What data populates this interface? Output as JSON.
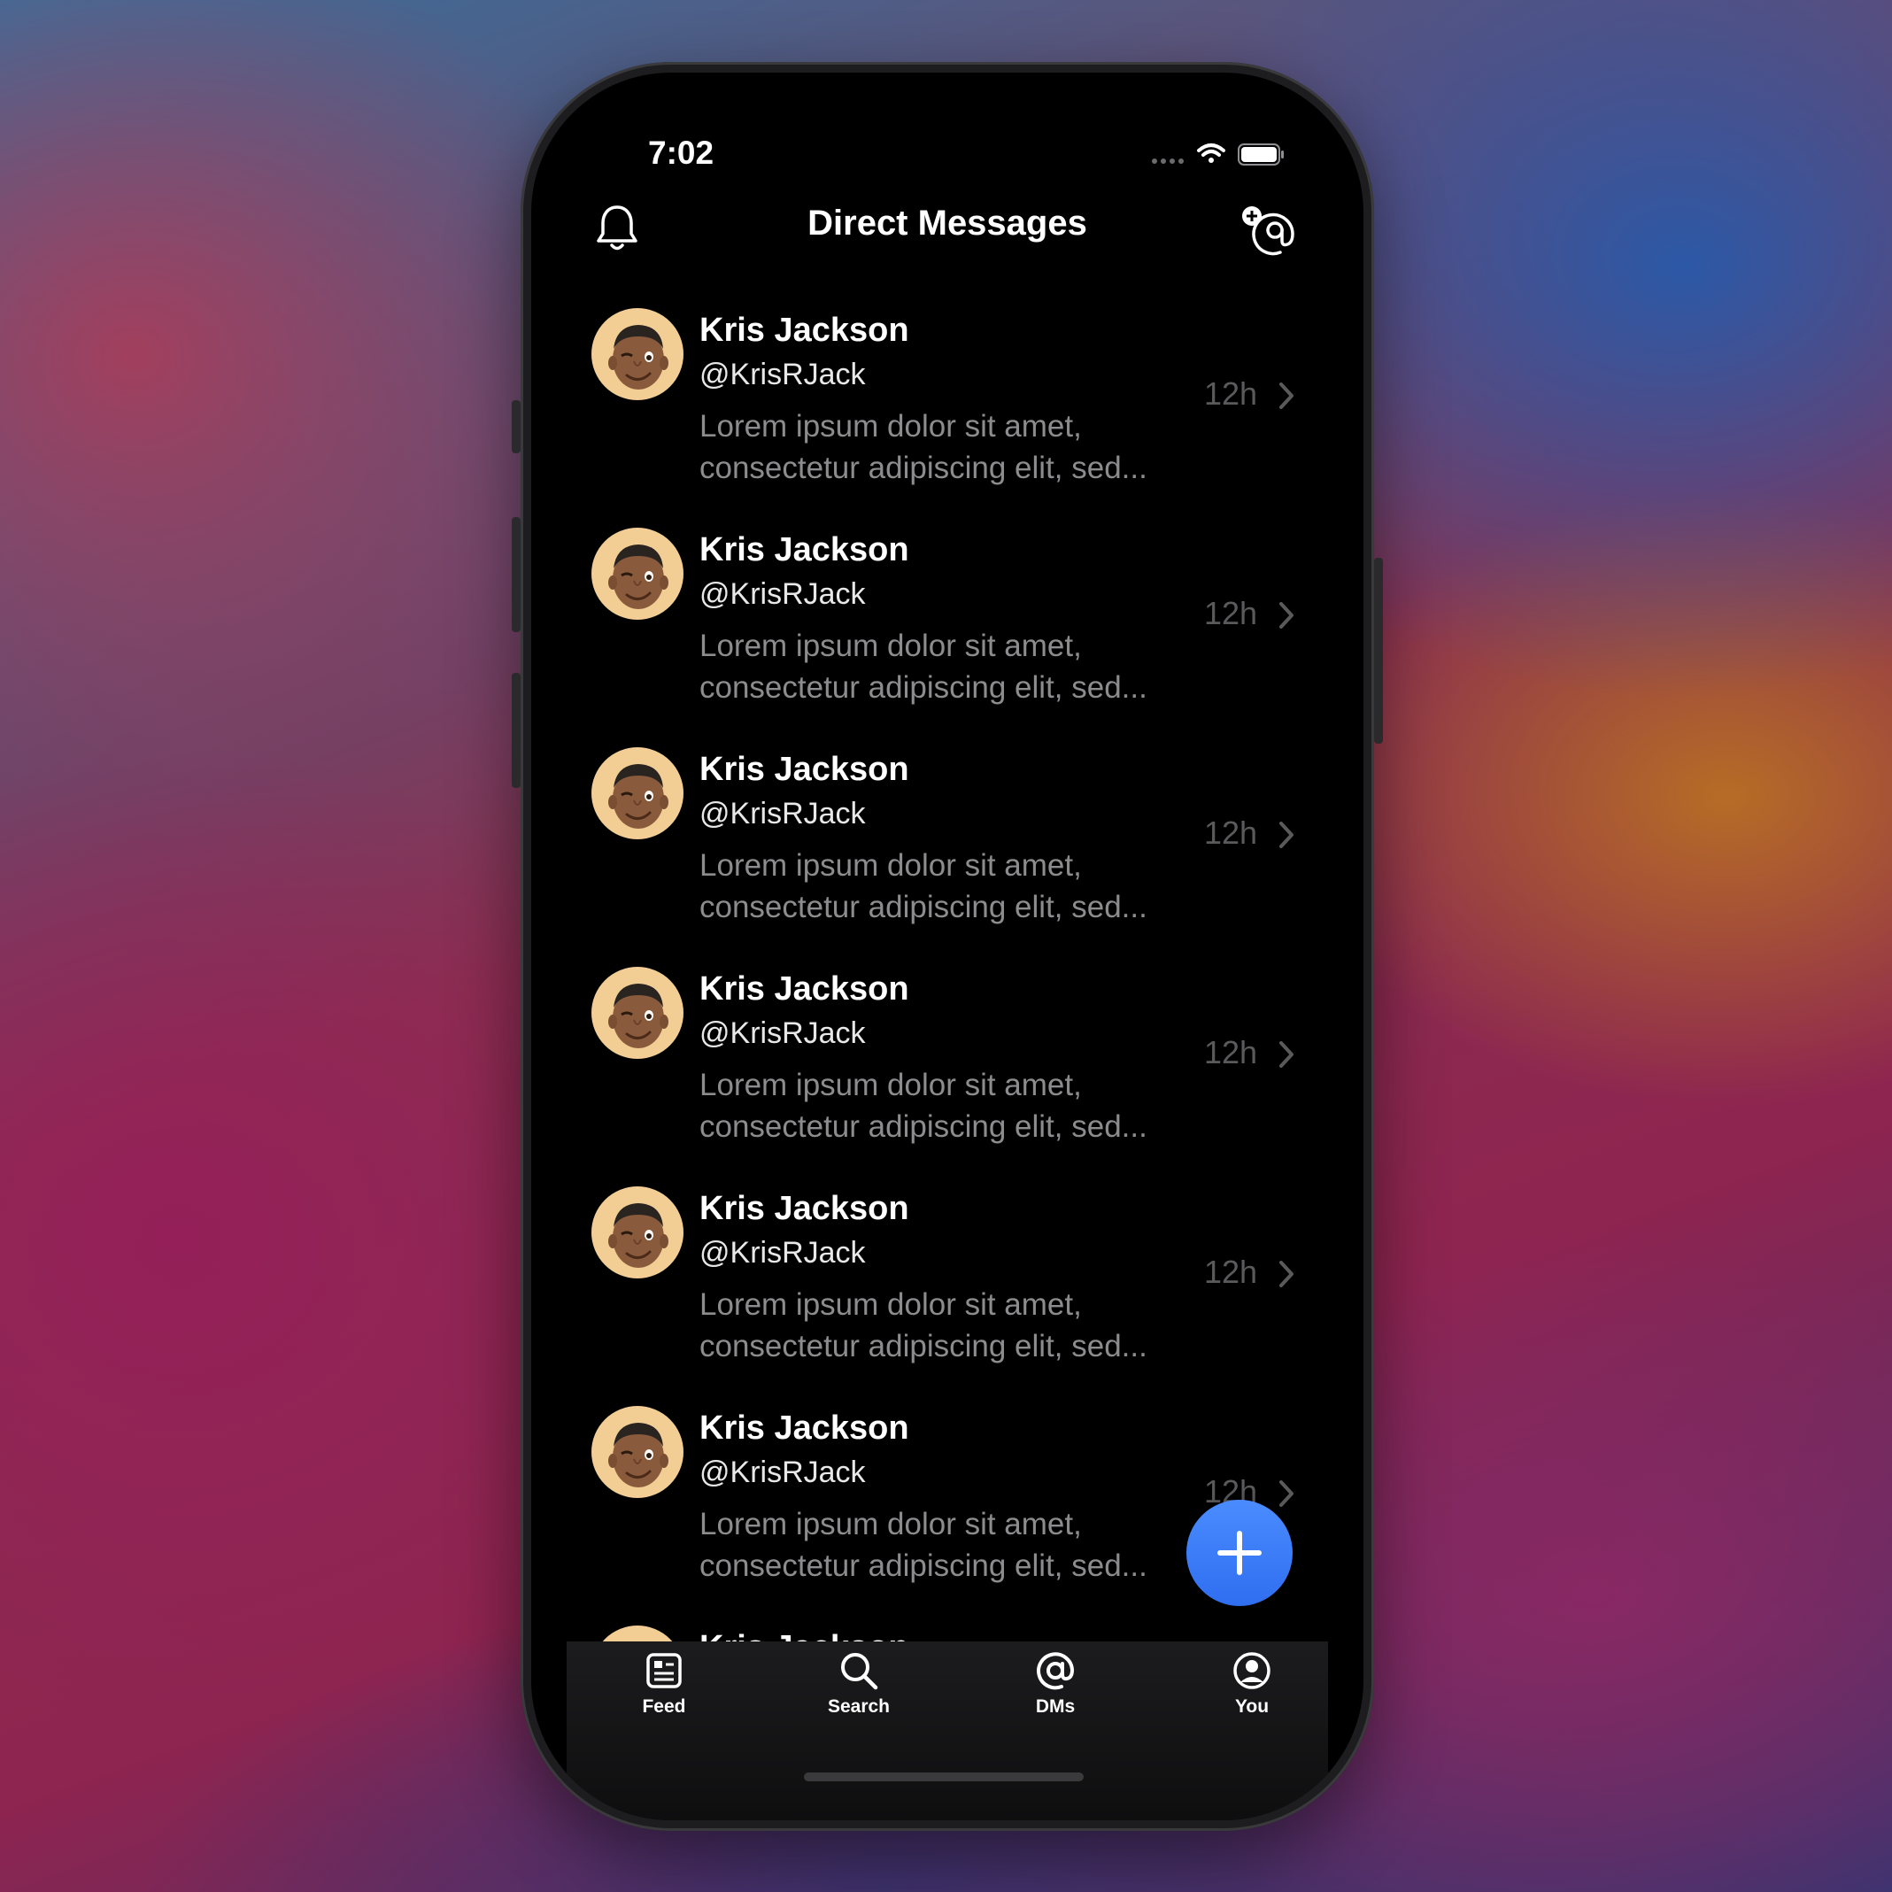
{
  "status": {
    "time": "7:02"
  },
  "header": {
    "title": "Direct Messages"
  },
  "messages": [
    {
      "name": "Kris Jackson",
      "handle": "@KrisRJack",
      "line1": "Lorem ipsum dolor sit amet,",
      "line2": "consectetur adipiscing elit, sed...",
      "time": "12h"
    },
    {
      "name": "Kris Jackson",
      "handle": "@KrisRJack",
      "line1": "Lorem ipsum dolor sit amet,",
      "line2": "consectetur adipiscing elit, sed...",
      "time": "12h"
    },
    {
      "name": "Kris Jackson",
      "handle": "@KrisRJack",
      "line1": "Lorem ipsum dolor sit amet,",
      "line2": "consectetur adipiscing elit, sed...",
      "time": "12h"
    },
    {
      "name": "Kris Jackson",
      "handle": "@KrisRJack",
      "line1": "Lorem ipsum dolor sit amet,",
      "line2": "consectetur adipiscing elit, sed...",
      "time": "12h"
    },
    {
      "name": "Kris Jackson",
      "handle": "@KrisRJack",
      "line1": "Lorem ipsum dolor sit amet,",
      "line2": "consectetur adipiscing elit, sed...",
      "time": "12h"
    },
    {
      "name": "Kris Jackson",
      "handle": "@KrisRJack",
      "line1": "Lorem ipsum dolor sit amet,",
      "line2": "consectetur adipiscing elit, sed...",
      "time": "12h"
    },
    {
      "name": "Kris Jackson",
      "handle": "",
      "line1": "",
      "line2": "",
      "time": ""
    }
  ],
  "tabs": [
    {
      "label": "Feed",
      "icon": "feed-icon"
    },
    {
      "label": "Search",
      "icon": "search-icon"
    },
    {
      "label": "DMs",
      "icon": "at-icon"
    },
    {
      "label": "You",
      "icon": "person-circle-icon"
    }
  ],
  "colors": {
    "accent": "#3478f6",
    "avatar_bg": "#f2cd94",
    "muted": "#8c8c8e"
  }
}
